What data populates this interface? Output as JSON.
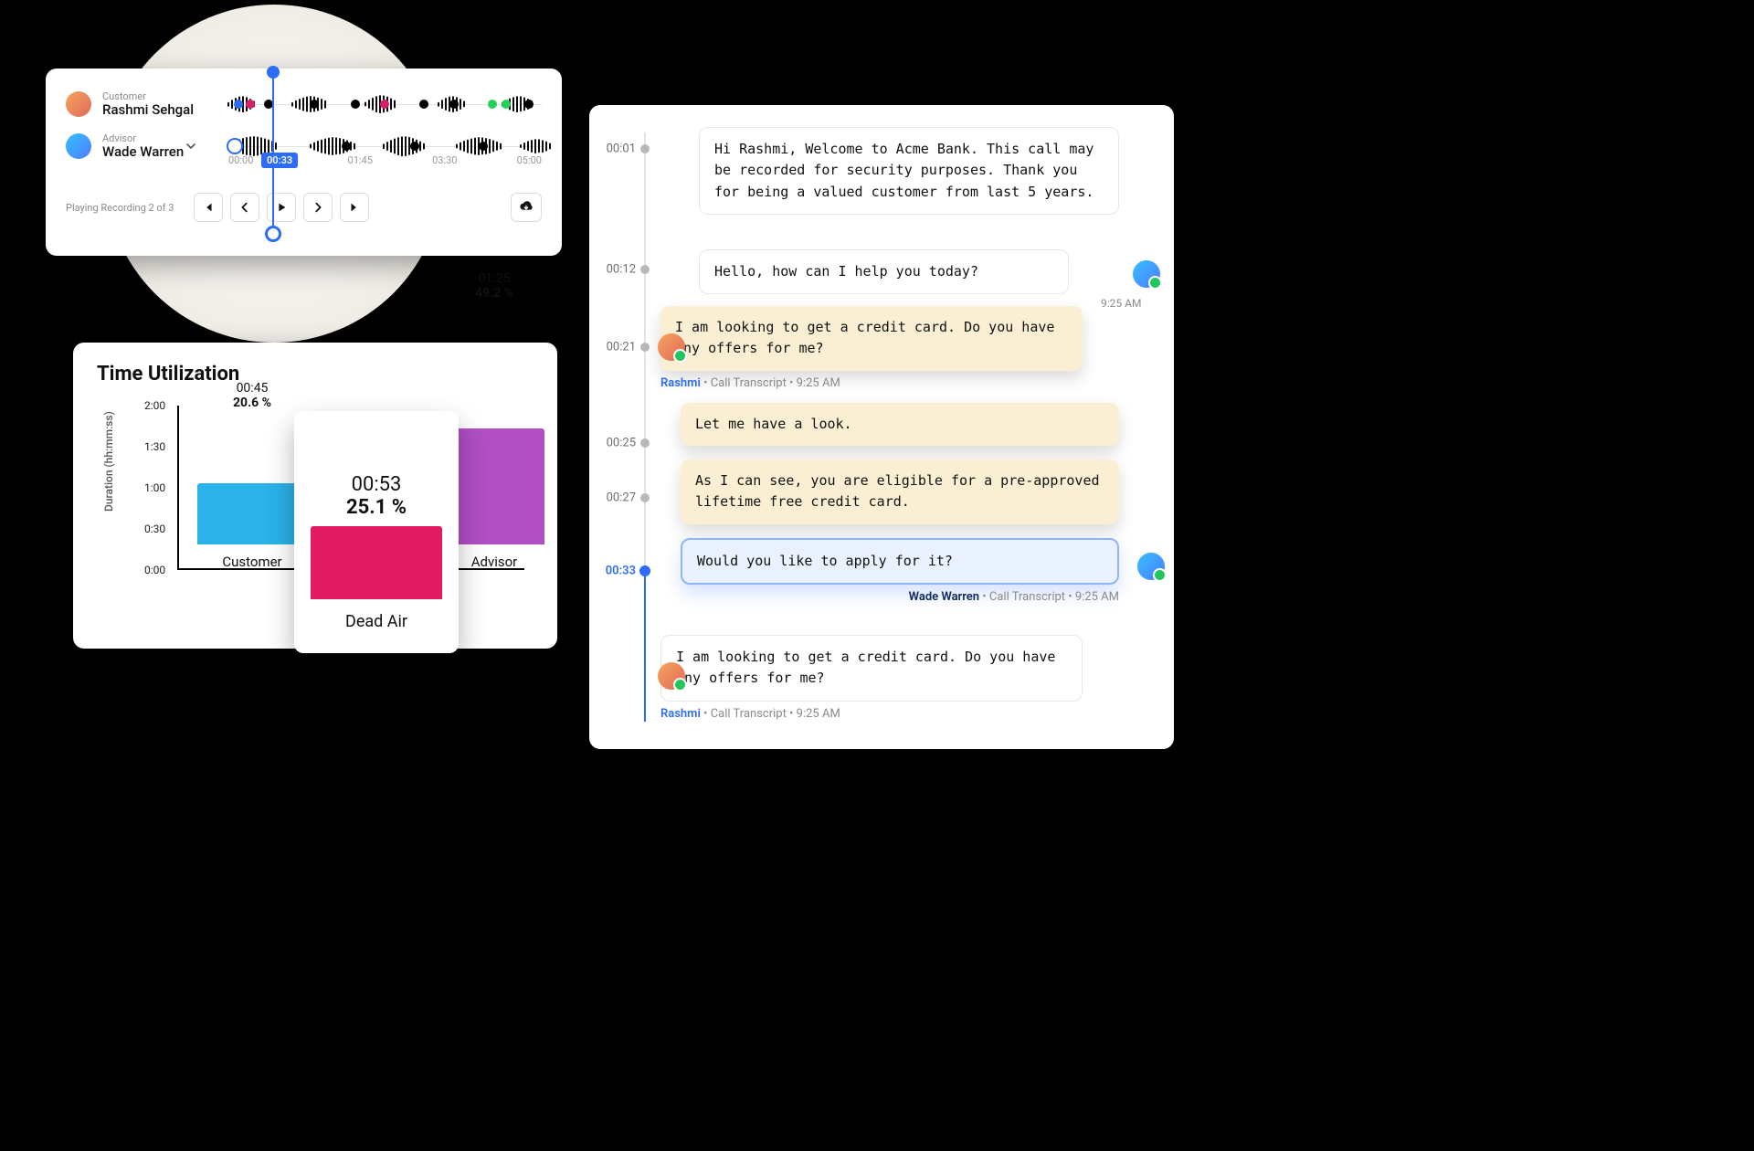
{
  "player": {
    "customer_label": "Customer",
    "customer_name": "Rashmi Sehgal",
    "advisor_label": "Advisor",
    "advisor_name": "Wade Warren",
    "current_time": "00:33",
    "ticks": [
      "00:00",
      "01:45",
      "03:30",
      "05:00"
    ],
    "status": "Playing Recording 2 of 3"
  },
  "chart": {
    "title": "Time Utilization",
    "ylabel": "Duration (hh:mm:ss)",
    "yticks": [
      "0:00",
      "0:30",
      "1:00",
      "1:30",
      "2:00"
    ],
    "customer": {
      "label": "Customer",
      "duration": "00:45",
      "percent": "20.6 %"
    },
    "deadair": {
      "label": "Dead Air",
      "duration": "00:53",
      "percent": "25.1 %"
    },
    "advisor": {
      "label": "Advisor",
      "duration": "01:25",
      "percent": "49.2 %"
    }
  },
  "chart_data": {
    "type": "bar",
    "title": "Time Utilization",
    "ylabel": "Duration (hh:mm:ss)",
    "ylim": [
      0,
      120
    ],
    "yticks_seconds": [
      0,
      30,
      60,
      90,
      120
    ],
    "yticks_labels": [
      "0:00",
      "0:30",
      "1:00",
      "1:30",
      "2:00"
    ],
    "categories": [
      "Customer",
      "Dead Air",
      "Advisor"
    ],
    "series": [
      {
        "name": "Duration (s)",
        "values": [
          45,
          53,
          85
        ]
      },
      {
        "name": "Percent",
        "values": [
          20.6,
          25.1,
          49.2
        ]
      }
    ],
    "value_labels": [
      "00:45",
      "00:53",
      "01:25"
    ],
    "colors": {
      "Customer": "#2bb2e8",
      "Dead Air": "#e11a62",
      "Advisor": "#b14fc4"
    }
  },
  "transcript": {
    "times": {
      "t1": "00:01",
      "t2": "00:12",
      "t3": "00:21",
      "t4": "00:25",
      "t5": "00:27",
      "t6": "00:33"
    },
    "m1": "Hi Rashmi, Welcome to Acme Bank. This call may be recorded for security purposes. Thank you for being a valued customer from last 5 years.",
    "m2": "Hello, how can I help you today?",
    "m3": "I am looking to get a credit card. Do you have any offers for me?",
    "m4": "Let me have a look.",
    "m5": "As I can see, you are eligible for a pre-approved lifetime free credit card.",
    "m6": "Would you like to apply for it?",
    "m7": "I am looking to get a credit card. Do you have any offers for me?",
    "meta_rashmi_name": "Rashmi",
    "meta_wade_name": "Wade Warren",
    "meta_tail": " • Call Transcript • 9:25 AM",
    "side_time": "9:25 AM"
  }
}
